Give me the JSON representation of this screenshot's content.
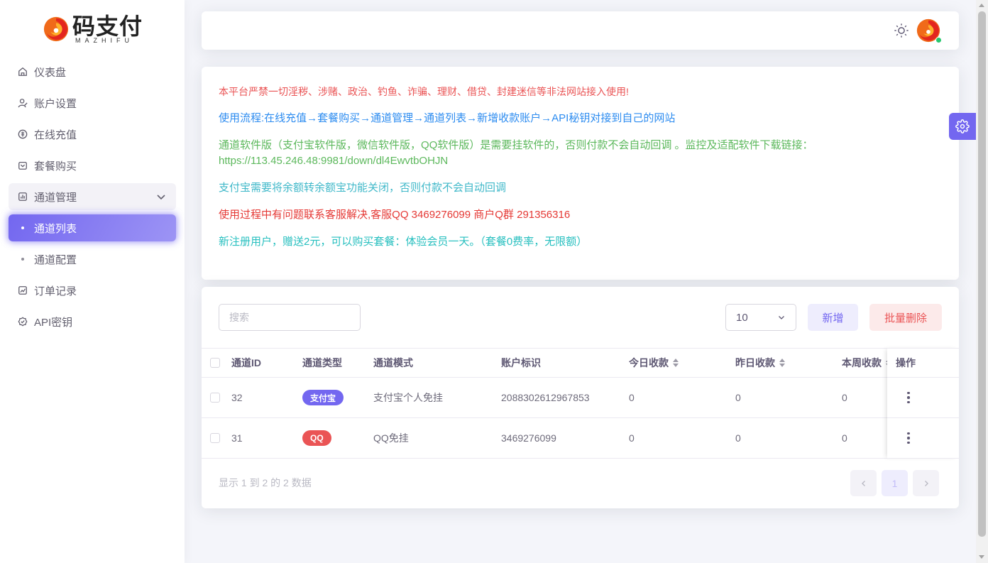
{
  "brand": {
    "name": "码支付",
    "sub": "MAZHIFU"
  },
  "sidebar": {
    "items": [
      {
        "label": "仪表盘",
        "icon": "home-icon"
      },
      {
        "label": "账户设置",
        "icon": "user-edit-icon"
      },
      {
        "label": "在线充值",
        "icon": "coin-icon"
      },
      {
        "label": "套餐购买",
        "icon": "package-icon"
      },
      {
        "label": "通道管理",
        "icon": "bar-chart-icon",
        "expanded": true
      },
      {
        "label": "通道列表",
        "active": true
      },
      {
        "label": "通道配置"
      },
      {
        "label": "订单记录",
        "icon": "trend-icon"
      },
      {
        "label": "API密钥",
        "icon": "key-badge-icon"
      }
    ]
  },
  "header": {
    "theme_toggle_icon": "sun-icon",
    "avatar_status": "online"
  },
  "notice": {
    "line1": "本平台严禁一切淫秽、涉赌、政治、钓鱼、诈骗、理财、借贷、封建迷信等非法网站接入使用!",
    "line2": "使用流程:在线充值→套餐购买→通道管理→通道列表→新增收款账户→API秘钥对接到自己的网站",
    "line3a": "通道软件版（支付宝软件版，微信软件版，QQ软件版）是需要挂软件的，否则付款不会自动回调 。监控及适配软件下载链接：",
    "line3b": "https://113.45.246.48:9981/down/dl4EwvtbOHJN",
    "line4": "支付宝需要将余额转余额宝功能关闭，否则付款不会自动回调",
    "line5": "使用过程中有问题联系客服解决,客服QQ 3469276099   商户Q群 291356316",
    "line6": "新注册用户，赠送2元，可以购买套餐：体验会员一天。（套餐0费率，无限额）"
  },
  "toolbar": {
    "search_placeholder": "搜索",
    "page_size": "10",
    "add_label": "新增",
    "batch_delete_label": "批量删除"
  },
  "table": {
    "columns": [
      "通道ID",
      "通道类型",
      "通道模式",
      "账户标识",
      "今日收款",
      "昨日收款",
      "本周收款",
      "操作",
      "本"
    ],
    "rows": [
      {
        "id": "32",
        "type": "支付宝",
        "type_color": "#7367f0",
        "mode": "支付宝个人免挂",
        "account": "2088302612967853",
        "today": "0",
        "yesterday": "0",
        "week": "0"
      },
      {
        "id": "31",
        "type": "QQ",
        "type_color": "#ea5455",
        "mode": "QQ免挂",
        "account": "3469276099",
        "today": "0",
        "yesterday": "0",
        "week": "0"
      }
    ]
  },
  "footer": {
    "info": "显示 1 到 2 的 2 数据",
    "current_page": "1"
  },
  "colors": {
    "accent": "#7367f0",
    "danger": "#ea5455",
    "success": "#28c76f"
  }
}
